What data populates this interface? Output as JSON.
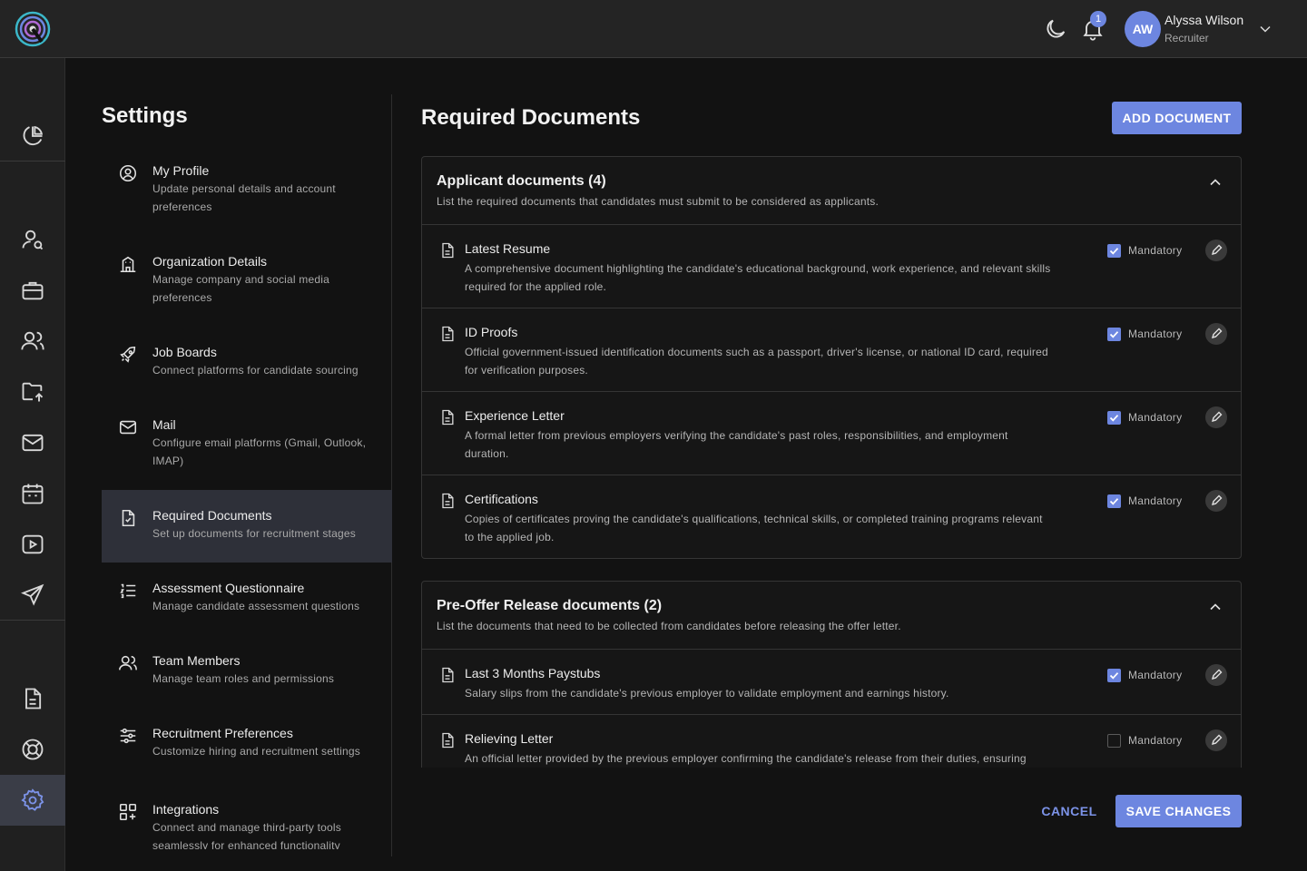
{
  "header": {
    "notification_count": "1",
    "user": {
      "initials": "AW",
      "name": "Alyssa Wilson",
      "role": "Recruiter"
    },
    "icons": [
      "moon-icon",
      "bell-icon",
      "chevron-down-icon"
    ]
  },
  "rail": {
    "icons": [
      "chart-pie-icon",
      "user-search-icon",
      "briefcase-icon",
      "users-icon",
      "folder-upload-icon",
      "mail-icon",
      "calendar-icon",
      "video-icon",
      "send-icon",
      "file-text-icon",
      "support-icon",
      "settings-icon"
    ],
    "active": "settings-icon"
  },
  "settings": {
    "title": "Settings",
    "items": [
      {
        "title": "My Profile",
        "desc": "Update personal details and account preferences",
        "icon": "user-circle-icon"
      },
      {
        "title": "Organization Details",
        "desc": "Manage company and social media preferences",
        "icon": "building-icon"
      },
      {
        "title": "Job Boards",
        "desc": "Connect platforms for candidate sourcing",
        "icon": "rocket-icon"
      },
      {
        "title": "Mail",
        "desc": "Configure email platforms (Gmail, Outlook, IMAP)",
        "icon": "mail-icon"
      },
      {
        "title": "Required Documents",
        "desc": "Set up documents for recruitment stages",
        "icon": "document-check-icon"
      },
      {
        "title": "Assessment Questionnaire",
        "desc": "Manage candidate assessment questions",
        "icon": "list-icon"
      },
      {
        "title": "Team Members",
        "desc": "Manage team roles and permissions",
        "icon": "team-icon"
      },
      {
        "title": "Recruitment Preferences",
        "desc": "Customize hiring and recruitment settings",
        "icon": "sliders-icon"
      },
      {
        "title": "Integrations",
        "desc": "Connect and manage third-party tools seamlessly for enhanced functionality",
        "icon": "apps-icon"
      }
    ],
    "active_index": 4
  },
  "main": {
    "title": "Required Documents",
    "add_button": "ADD DOCUMENT",
    "cancel_button": "CANCEL",
    "save_button": "SAVE CHANGES",
    "mandatory_label": "Mandatory",
    "accent_color": "#6d86e0",
    "groups": [
      {
        "title": "Applicant documents (4)",
        "desc": "List the required documents that candidates must submit to be considered as applicants.",
        "docs": [
          {
            "title": "Latest Resume",
            "desc": "A comprehensive document highlighting the candidate's educational background, work experience, and relevant skills required for the applied role.",
            "mandatory": true
          },
          {
            "title": "ID Proofs",
            "desc": "Official government-issued identification documents such as a passport, driver's license, or national ID card, required for verification purposes.",
            "mandatory": true
          },
          {
            "title": "Experience Letter",
            "desc": "A formal letter from previous employers verifying the candidate's past roles, responsibilities, and employment duration.",
            "mandatory": true
          },
          {
            "title": "Certifications",
            "desc": "Copies of certificates proving the candidate's qualifications, technical skills, or completed training programs relevant to the applied job.",
            "mandatory": true
          }
        ]
      },
      {
        "title": "Pre-Offer Release documents (2)",
        "desc": "List the documents that need to be collected from candidates before releasing the offer letter.",
        "docs": [
          {
            "title": "Last 3 Months Paystubs",
            "desc": "Salary slips from the candidate's previous employer to validate employment and earnings history.",
            "mandatory": true
          },
          {
            "title": "Relieving Letter",
            "desc": "An official letter provided by the previous employer confirming the candidate's release from their duties, ensuring",
            "mandatory": false
          }
        ]
      }
    ]
  }
}
